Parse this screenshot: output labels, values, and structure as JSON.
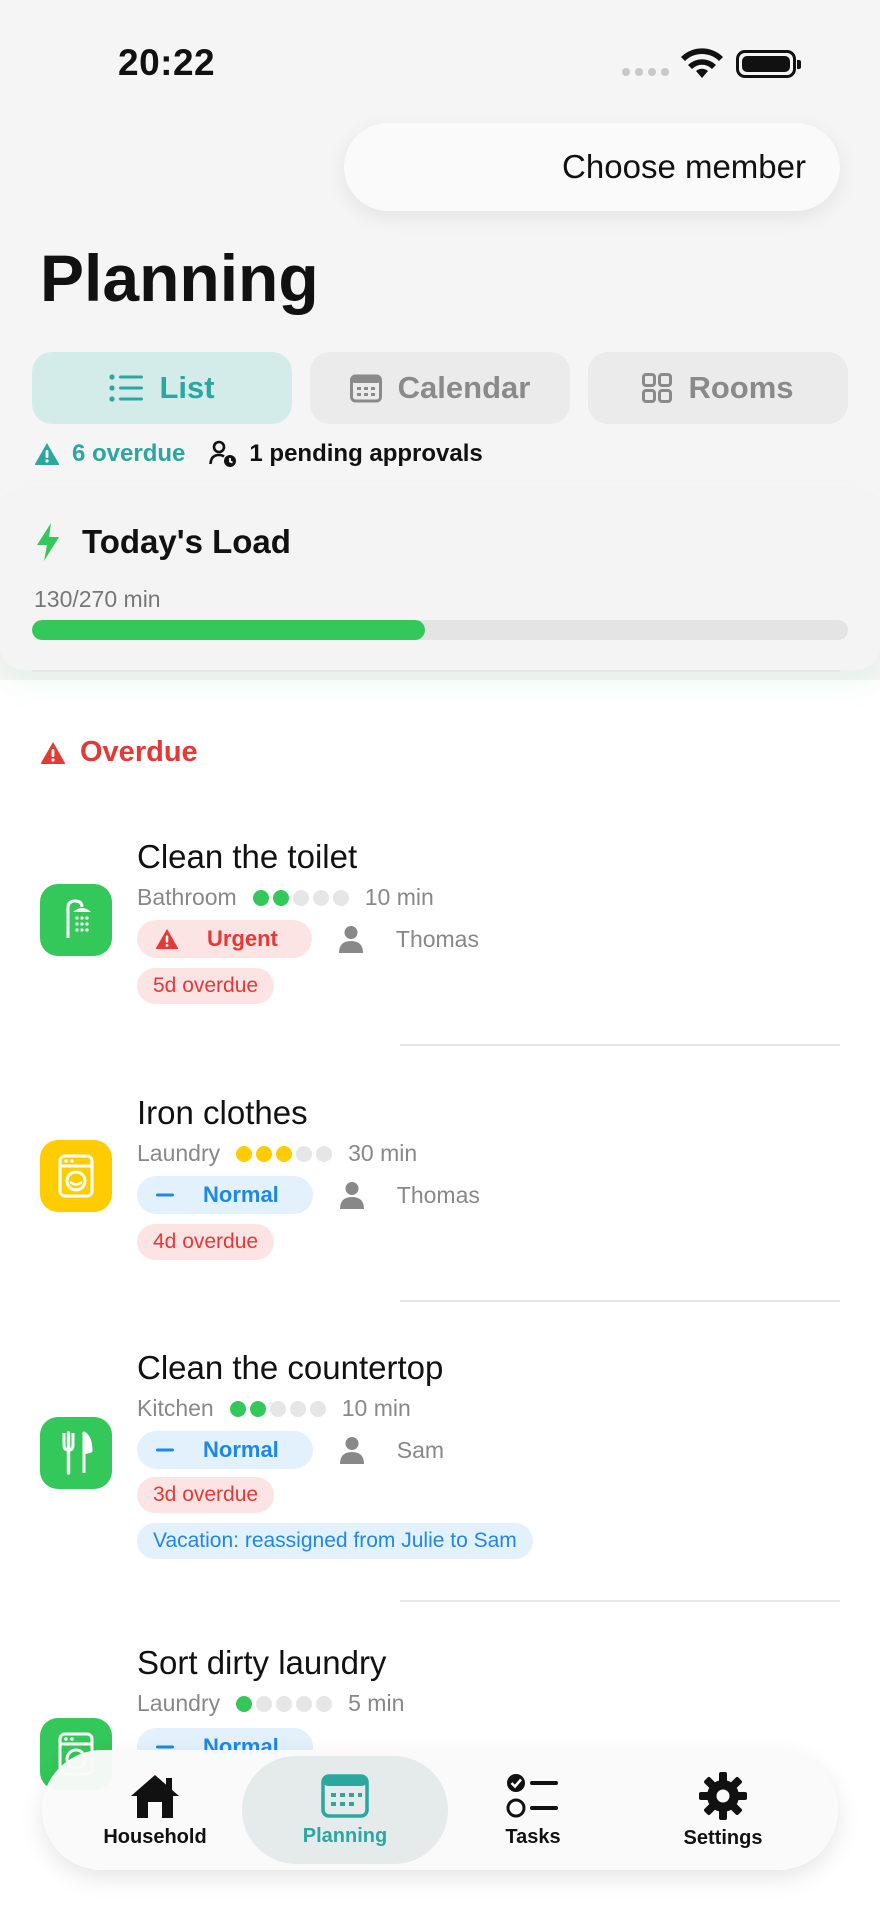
{
  "status_bar": {
    "time": "20:22"
  },
  "header": {
    "member_selector": "Choose member",
    "title": "Planning"
  },
  "view_tabs": [
    {
      "label": "List",
      "icon": "list-icon",
      "active": true
    },
    {
      "label": "Calendar",
      "icon": "calendar-icon",
      "active": false
    },
    {
      "label": "Rooms",
      "icon": "grid-icon",
      "active": false
    }
  ],
  "summary": {
    "overdue": "6 overdue",
    "pending": "1 pending approvals"
  },
  "load": {
    "title": "Today's Load",
    "value_text": "130/270 min",
    "progress_fraction": 0.4815
  },
  "section": {
    "title": "Overdue"
  },
  "tasks": [
    {
      "name": "Clean the toilet",
      "room": "Bathroom",
      "icon": "shower-icon",
      "icon_color": "#34c759",
      "difficulty": 2,
      "dot_color": "green",
      "duration": "10 min",
      "priority": "Urgent",
      "priority_type": "urgent",
      "assignee": "Thomas",
      "overdue": "5d overdue"
    },
    {
      "name": "Iron clothes",
      "room": "Laundry",
      "icon": "washing-machine-icon",
      "icon_color": "#ffcc00",
      "difficulty": 3,
      "dot_color": "yellow",
      "duration": "30 min",
      "priority": "Normal",
      "priority_type": "normal",
      "assignee": "Thomas",
      "overdue": "4d overdue"
    },
    {
      "name": "Clean the countertop",
      "room": "Kitchen",
      "icon": "fork-knife-icon",
      "icon_color": "#34c759",
      "difficulty": 2,
      "dot_color": "green",
      "duration": "10 min",
      "priority": "Normal",
      "priority_type": "normal",
      "assignee": "Sam",
      "overdue": "3d overdue",
      "note": "Vacation: reassigned from Julie to Sam"
    },
    {
      "name": "Sort dirty laundry",
      "room": "Laundry",
      "icon": "washing-machine-icon",
      "icon_color": "#34c759",
      "difficulty": 1,
      "dot_color": "green",
      "duration": "5 min",
      "priority": "Normal",
      "priority_type": "normal"
    }
  ],
  "bottom_tabs": [
    {
      "label": "Household",
      "icon": "house-icon",
      "active": false
    },
    {
      "label": "Planning",
      "icon": "calendar-icon",
      "active": true
    },
    {
      "label": "Tasks",
      "icon": "checklist-icon",
      "active": false
    },
    {
      "label": "Settings",
      "icon": "gear-icon",
      "active": false
    }
  ],
  "colors": {
    "accent": "#2aa7a0",
    "green": "#34c759",
    "yellow": "#ffcc00",
    "urgent_red": "#e53935",
    "normal_blue": "#1e88e5"
  }
}
